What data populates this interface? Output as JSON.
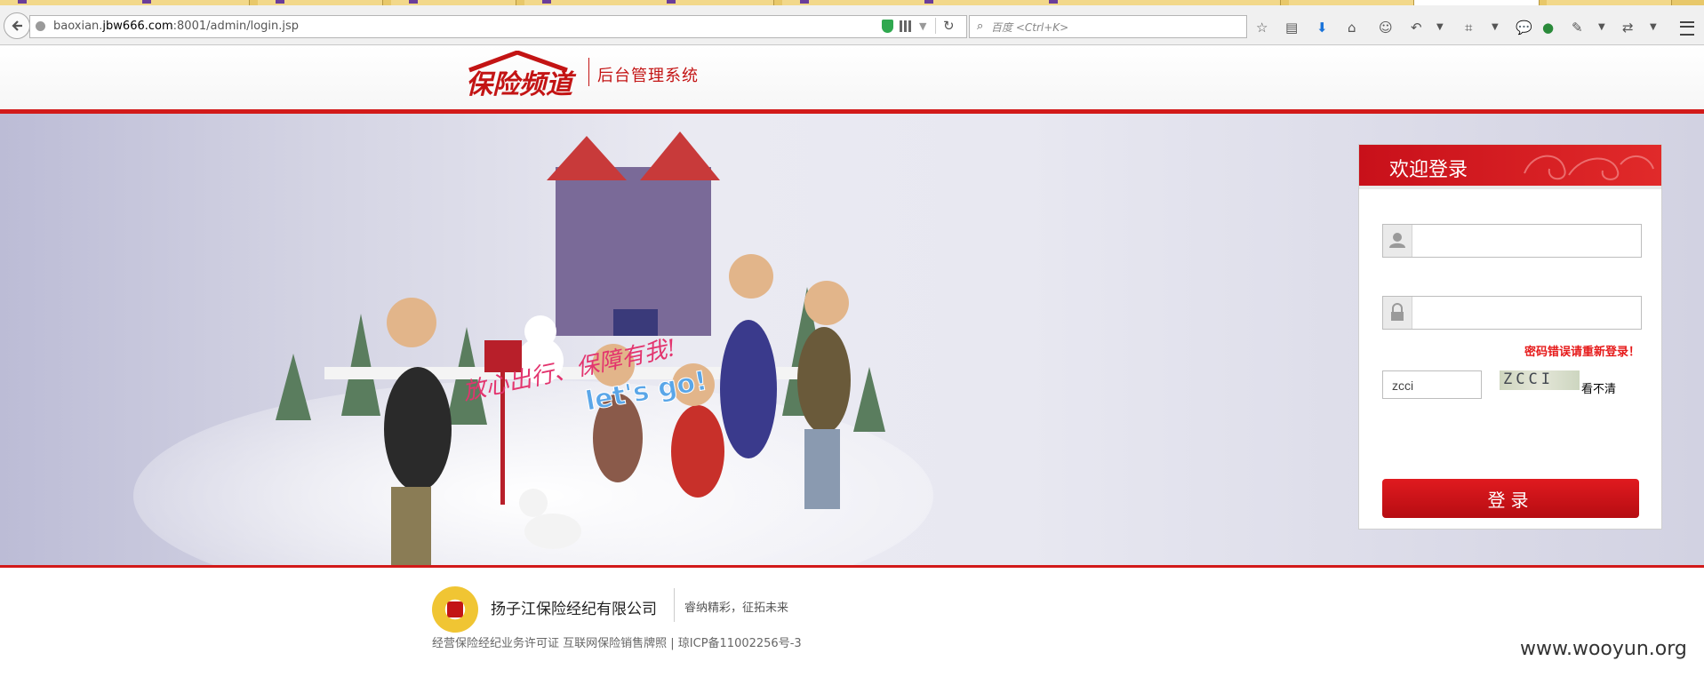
{
  "browser": {
    "url_prefix": "baoxian.",
    "url_domain": "jbw666.com",
    "url_suffix": ":8001/admin/login.jsp",
    "search_placeholder": "百度 <Ctrl+K>"
  },
  "header": {
    "logo_text": "保险频道",
    "system_title": "后台管理系统"
  },
  "banner": {
    "slogan_cn": "放心出行、保障有我!",
    "slogan_en": "let's go!"
  },
  "login": {
    "title": "欢迎登录",
    "username_value": "",
    "password_value": "",
    "error_message": "密码错误请重新登录！",
    "captcha_value": "zcci",
    "captcha_image_text": "ZCCI",
    "captcha_refresh_label": "看不清",
    "submit_label": "登录"
  },
  "footer": {
    "company": "扬子江保险经纪有限公司",
    "slogan": "睿纳精彩，征拓未来",
    "license": "经营保险经纪业务许可证 互联网保险销售牌照 | 琼ICP备11002256号-3"
  },
  "watermark": "www.wooyun.org",
  "colors": {
    "brand_red": "#d21a1a",
    "error_red": "#e61a1a"
  }
}
